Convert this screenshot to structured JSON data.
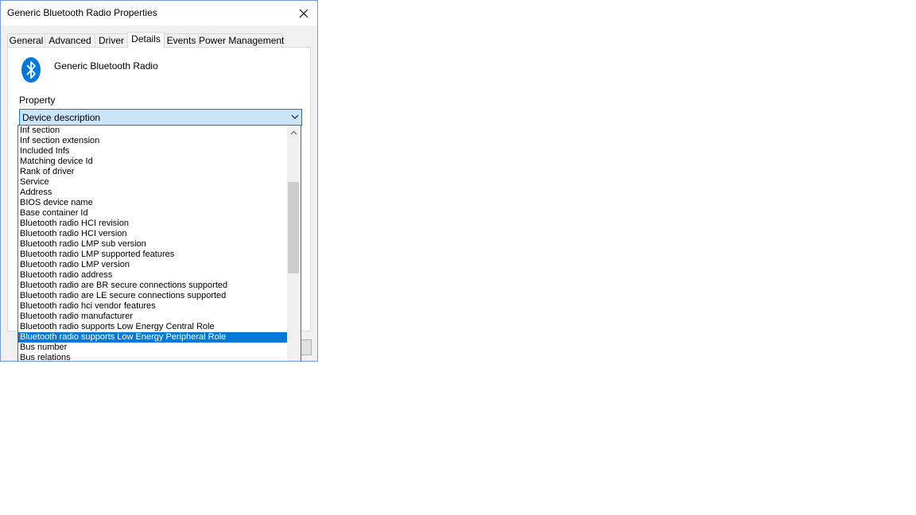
{
  "window": {
    "title": "Generic Bluetooth Radio Properties"
  },
  "tabs": [
    {
      "label": "General"
    },
    {
      "label": "Advanced"
    },
    {
      "label": "Driver"
    },
    {
      "label": "Details",
      "active": true
    },
    {
      "label": "Events"
    },
    {
      "label": "Power Management"
    }
  ],
  "device": {
    "name": "Generic Bluetooth Radio",
    "icon": "bluetooth-icon",
    "icon_color": "#0078d7"
  },
  "property": {
    "label": "Property",
    "selected_value": "Device description"
  },
  "dropdown": {
    "items": [
      "Inf section",
      "Inf section extension",
      "Included Infs",
      "Matching device Id",
      "Rank of driver",
      "Service",
      "Address",
      "BIOS device name",
      "Base container Id",
      "Bluetooth radio HCI revision",
      "Bluetooth radio HCI version",
      "Bluetooth radio LMP sub version",
      "Bluetooth radio LMP supported features",
      "Bluetooth radio LMP version",
      "Bluetooth radio address",
      "Bluetooth radio are BR secure connections supported",
      "Bluetooth radio are LE secure connections supported",
      "Bluetooth radio hci vendor features",
      "Bluetooth radio manufacturer",
      "Bluetooth radio supports Low Energy Central Role",
      "Bluetooth radio supports Low Energy Peripheral Role",
      "Bus number",
      "Bus relations"
    ],
    "highlighted": "Bluetooth radio supports Low Energy Peripheral Role"
  },
  "colors": {
    "accent": "#0078d7",
    "combo_bg": "#cce4f7",
    "dialog_bg": "#f0f0f0"
  }
}
